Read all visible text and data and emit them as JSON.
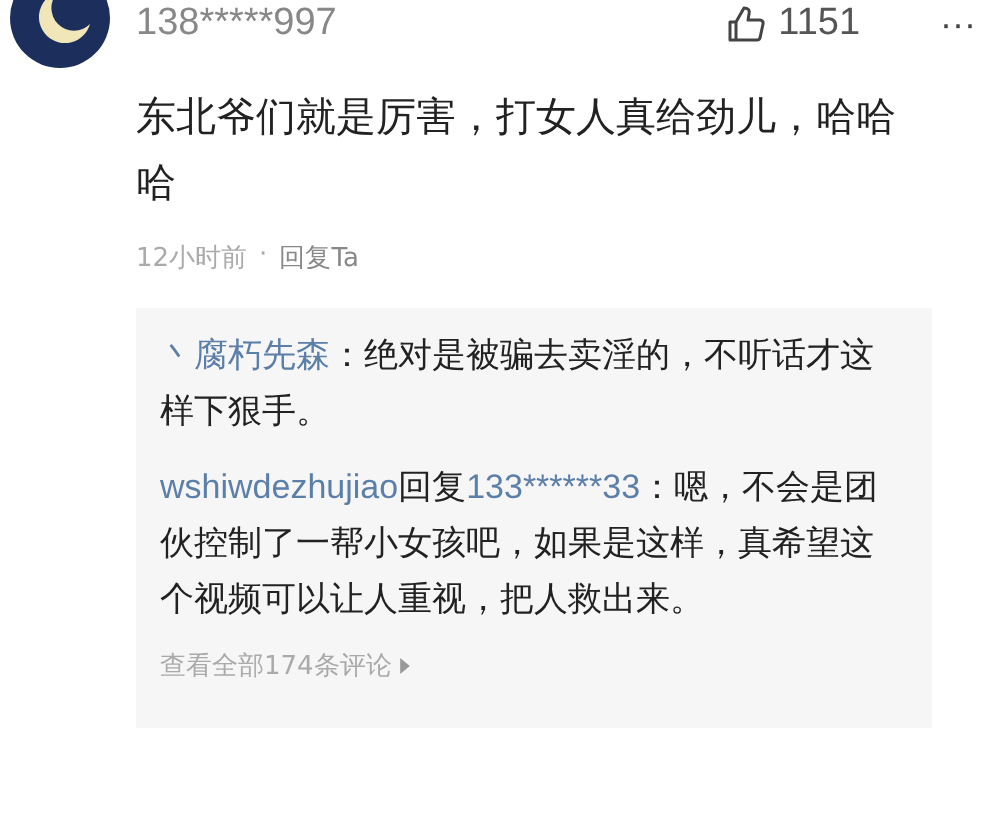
{
  "comment": {
    "username": "138*****997",
    "likes": "1151",
    "more": "···",
    "text": "东北爷们就是厉害，打女人真给劲儿，哈哈哈",
    "time": "12小时前",
    "separator": "·",
    "reply_action": "回复Ta"
  },
  "replies": [
    {
      "kind": "comment",
      "user": "丶腐朽先森",
      "text": "：绝对是被骗去卖淫的，不听话才这样下狠手。"
    },
    {
      "kind": "reply",
      "user": "wshiwdezhujiao",
      "reply_word": "回复",
      "target": "133******33",
      "text": "：嗯，不会是团伙控制了一帮小女孩吧，如果是这样，真希望这个视频可以让人重视，把人救出来。"
    }
  ],
  "view_all": "查看全部174条评论"
}
